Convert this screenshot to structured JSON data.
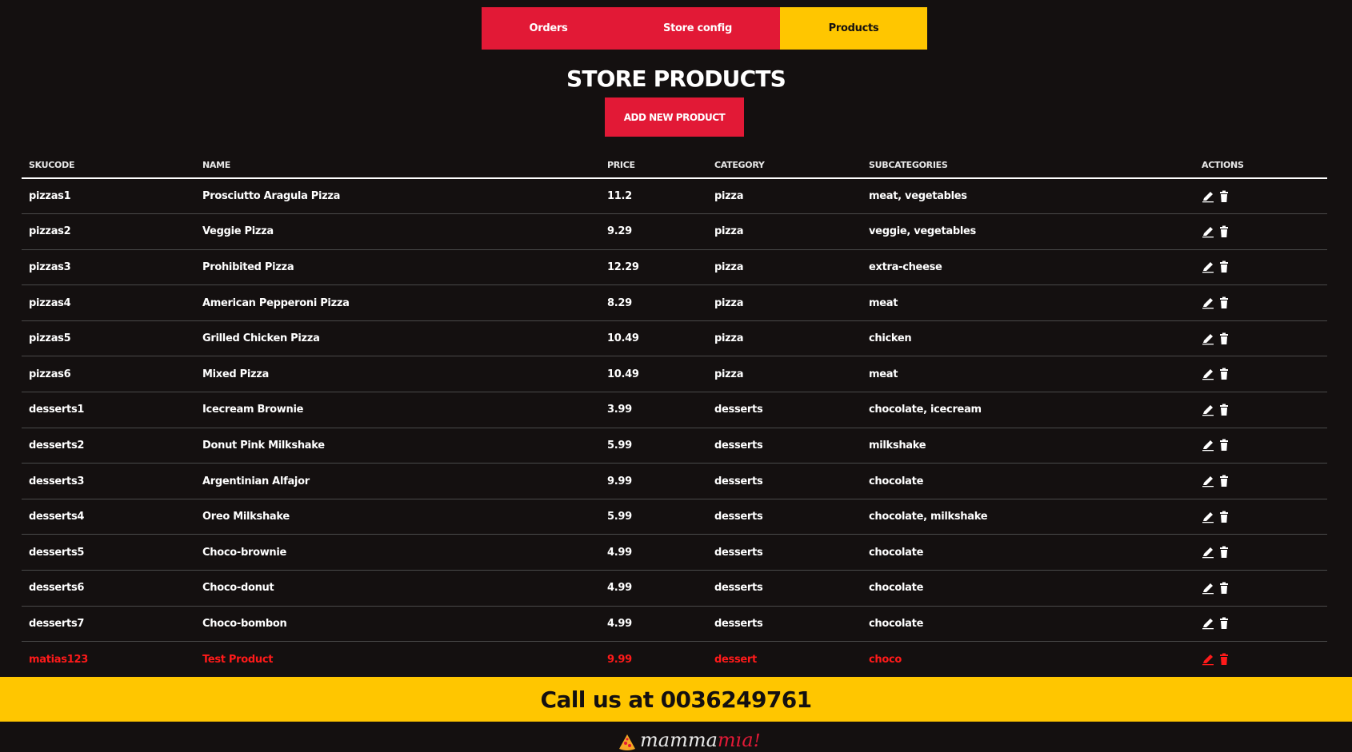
{
  "nav": {
    "tabs": [
      {
        "label": "Orders",
        "active": false
      },
      {
        "label": "Store config",
        "active": false
      },
      {
        "label": "Products",
        "active": true
      }
    ]
  },
  "page": {
    "title": "STORE PRODUCTS",
    "add_button_label": "ADD NEW PRODUCT"
  },
  "table": {
    "headers": [
      "SKUCODE",
      "NAME",
      "PRICE",
      "CATEGORY",
      "SUBCATEGORIES",
      "ACTIONS"
    ],
    "rows": [
      {
        "sku": "pizzas1",
        "name": "Prosciutto Aragula Pizza",
        "price": "11.2",
        "category": "pizza",
        "subcategories": "meat, vegetables"
      },
      {
        "sku": "pizzas2",
        "name": "Veggie Pizza",
        "price": "9.29",
        "category": "pizza",
        "subcategories": "veggie, vegetables"
      },
      {
        "sku": "pizzas3",
        "name": "Prohibited Pizza",
        "price": "12.29",
        "category": "pizza",
        "subcategories": "extra-cheese"
      },
      {
        "sku": "pizzas4",
        "name": "American Pepperoni Pizza",
        "price": "8.29",
        "category": "pizza",
        "subcategories": "meat"
      },
      {
        "sku": "pizzas5",
        "name": "Grilled Chicken Pizza",
        "price": "10.49",
        "category": "pizza",
        "subcategories": "chicken"
      },
      {
        "sku": "pizzas6",
        "name": "Mixed Pizza",
        "price": "10.49",
        "category": "pizza",
        "subcategories": "meat"
      },
      {
        "sku": "desserts1",
        "name": "Icecream Brownie",
        "price": "3.99",
        "category": "desserts",
        "subcategories": "chocolate, icecream"
      },
      {
        "sku": "desserts2",
        "name": "Donut Pink Milkshake",
        "price": "5.99",
        "category": "desserts",
        "subcategories": "milkshake"
      },
      {
        "sku": "desserts3",
        "name": "Argentinian Alfajor",
        "price": "9.99",
        "category": "desserts",
        "subcategories": "chocolate"
      },
      {
        "sku": "desserts4",
        "name": "Oreo Milkshake",
        "price": "5.99",
        "category": "desserts",
        "subcategories": "chocolate, milkshake"
      },
      {
        "sku": "desserts5",
        "name": "Choco-brownie",
        "price": "4.99",
        "category": "desserts",
        "subcategories": "chocolate"
      },
      {
        "sku": "desserts6",
        "name": "Choco-donut",
        "price": "4.99",
        "category": "desserts",
        "subcategories": "chocolate"
      },
      {
        "sku": "desserts7",
        "name": "Choco-bombon",
        "price": "4.99",
        "category": "desserts",
        "subcategories": "chocolate"
      },
      {
        "sku": "matias123",
        "name": "Test Product",
        "price": "9.99",
        "category": "dessert",
        "subcategories": "choco",
        "highlight": true
      }
    ],
    "action_icons": [
      "pencil-icon",
      "trash-icon"
    ]
  },
  "footer": {
    "call_text": "Call us at 0036249761",
    "logo_text_a": "mamma",
    "logo_text_b": "mia!"
  },
  "colors": {
    "background": "#141010",
    "accent_red": "#e21936",
    "accent_yellow": "#ffc600",
    "highlight_row": "#ff1a1a"
  }
}
